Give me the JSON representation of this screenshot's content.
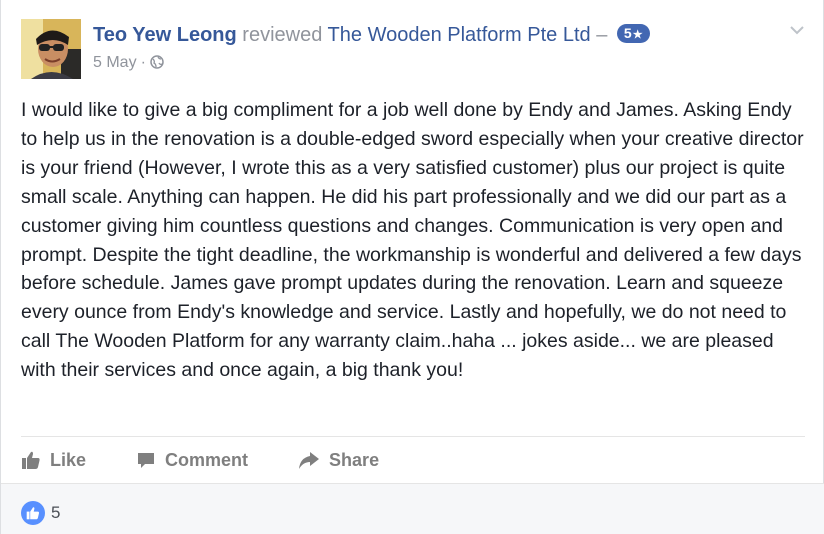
{
  "post": {
    "author": "Teo Yew Leong",
    "verb": "reviewed",
    "page_name": "The Wooden Platform Pte Ltd",
    "dash": "–",
    "rating": "5",
    "date": "5 May",
    "separator": "·",
    "text": "I would like to give a big compliment for a job well done by Endy and James. Asking Endy to help us in the renovation is a double-edged sword especially when your creative director is your friend (However, I wrote this as a very satisfied customer) plus our project is quite small scale. Anything can happen. He did his part professionally and we did our part as a customer giving him countless questions and changes. Communication is very open and prompt. Despite the tight deadline, the workmanship is wonderful and delivered a few days before schedule. James gave prompt updates during the renovation. Learn and squeeze every ounce from Endy's knowledge and service. Lastly and hopefully, we do not need to call The Wooden Platform for any warranty claim..haha       ... jokes aside... we are pleased with their services and once again, a big thank you!"
  },
  "actions": {
    "like": "Like",
    "comment": "Comment",
    "share": "Share"
  },
  "footer": {
    "like_count": "5"
  },
  "icons": {
    "badge_star": "star-icon",
    "audience": "globe-icon",
    "menu": "chevron-down-icon",
    "like": "thumbs-up-icon",
    "comment": "comment-icon",
    "share": "share-arrow-icon"
  },
  "colors": {
    "link_blue": "#365899",
    "badge_blue": "#4267b2",
    "muted_gray": "#90949c",
    "action_gray": "#7f7f7f",
    "like_bubble": "#5890ff",
    "footer_bg": "#f6f7f9"
  }
}
